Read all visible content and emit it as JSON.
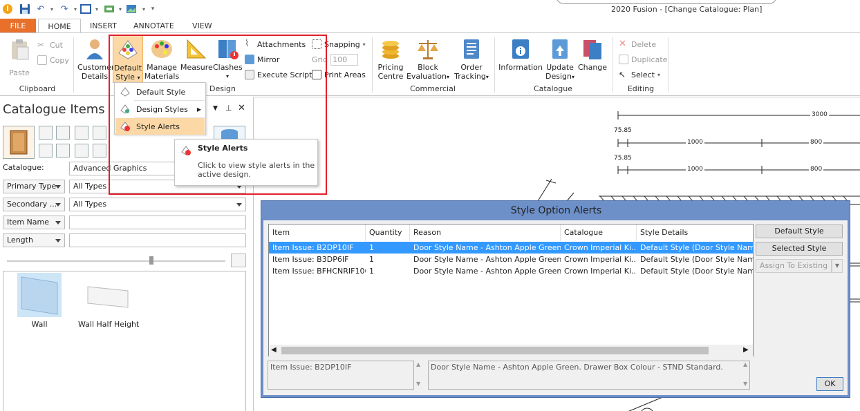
{
  "window": {
    "title": "2020 Fusion - [Change Catalogue: Plan]"
  },
  "tabs": [
    "FILE",
    "HOME",
    "INSERT",
    "ANNOTATE",
    "VIEW"
  ],
  "clipboard": {
    "paste": "Paste",
    "cut": "Cut",
    "copy": "Copy",
    "group": "Clipboard"
  },
  "ribbon_home": {
    "customer_details_l1": "Customer",
    "customer_details_l2": "Details",
    "default_style_l1": "Default",
    "default_style_l2": "Style",
    "manage_materials_l1": "Manage",
    "manage_materials_l2": "Materials",
    "measure": "Measure",
    "clashes": "Clashes",
    "attachments": "Attachments",
    "mirror": "Mirror",
    "execute_script": "Execute Script",
    "snapping": "Snapping",
    "grid": "Grid",
    "grid_value": "100",
    "print_areas": "Print Areas",
    "design_group": "Design"
  },
  "commercial": {
    "pricing_l1": "Pricing",
    "pricing_l2": "Centre",
    "block_l1": "Block",
    "block_l2": "Evaluation",
    "order_l1": "Order",
    "order_l2": "Tracking",
    "group": "Commercial"
  },
  "catalogue_group": {
    "information": "Information",
    "update_l1": "Update",
    "update_l2": "Design",
    "change": "Change",
    "group": "Catalogue"
  },
  "editing": {
    "delete": "Delete",
    "duplicate": "Duplicate",
    "select": "Select",
    "group": "Editing"
  },
  "dropdown": {
    "items": [
      "Default Style",
      "Design Styles",
      "Style Alerts"
    ]
  },
  "tooltip": {
    "title": "Style Alerts",
    "body_l1": "Click to view style alerts in the",
    "body_l2": "active design."
  },
  "left_pane": {
    "title": "Catalogue Items",
    "catalogue_label": "Catalogue:",
    "catalogue_value": "Advanced Graphics",
    "primary_type": "Primary Type",
    "primary_value": "All Types",
    "secondary_type": "Secondary ...",
    "secondary_value": "All Types",
    "item_name": "Item Name",
    "length": "Length",
    "items": [
      {
        "label": "Wall"
      },
      {
        "label": "Wall Half Height"
      }
    ]
  },
  "drawing": {
    "dims": [
      "3000",
      "75.85",
      "1000",
      "800",
      "75.85",
      "1000",
      "800"
    ]
  },
  "dialog": {
    "title": "Style Option Alerts",
    "columns": [
      "Item",
      "Quantity",
      "Reason",
      "Catalogue",
      "Style Details"
    ],
    "rows": [
      {
        "item": "Item Issue: B2DP10IF",
        "qty": "1",
        "reason": "Door Style Name - Ashton Apple Green. ...",
        "catalogue": "Crown Imperial Ki...",
        "style": "Default Style (Door Style Name (..."
      },
      {
        "item": "Item Issue: B3DP6IF",
        "qty": "1",
        "reason": "Door Style Name - Ashton Apple Green. ...",
        "catalogue": "Crown Imperial Ki...",
        "style": "Default Style (Door Style Name (..."
      },
      {
        "item": "Item Issue: BFHCNRIF106L",
        "qty": "1",
        "reason": "Door Style Name - Ashton Apple Green.",
        "catalogue": "Crown Imperial Ki...",
        "style": "Default Style (Door Style Name (..."
      }
    ],
    "buttons": {
      "default_style": "Default Style",
      "selected_style": "Selected Style",
      "assign": "Assign To Existing",
      "ok": "OK"
    },
    "detail_item": "Item Issue: B2DP10IF",
    "detail_reason": "Door Style Name - Ashton Apple Green. Drawer Box Colour -  STND Standard."
  },
  "colors": {
    "file_tab": "#e8702a",
    "highlight": "#fbd8a6",
    "red_frame": "#e0202a",
    "dialog_frame": "#6d90c9",
    "selection": "#3399ff"
  }
}
